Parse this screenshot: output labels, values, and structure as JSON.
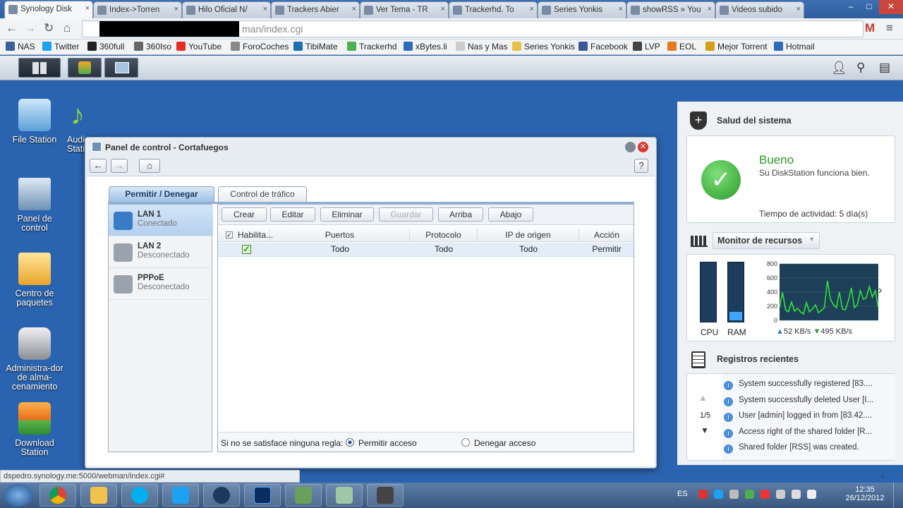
{
  "browser": {
    "tabs": [
      {
        "title": "Synology Disk",
        "active": true
      },
      {
        "title": "Index->Torren"
      },
      {
        "title": "Hilo Oficial N/"
      },
      {
        "title": "Trackers Abier"
      },
      {
        "title": "Ver Tema - TR"
      },
      {
        "title": "Trackerhd. To"
      },
      {
        "title": "Series Yonkis"
      },
      {
        "title": "showRSS » You"
      },
      {
        "title": "Videos subido"
      }
    ],
    "tab_close": "×",
    "window_controls": {
      "minimize": "–",
      "maximize": "□",
      "close": "✕"
    },
    "url": "man/index.cgi",
    "bookmarks": [
      "NAS",
      "Twitter",
      "360full",
      "360Iso",
      "YouTube",
      "ForoCoches",
      "TibiMate",
      "Trackerhd",
      "xBytes.li",
      "Nas y Mas",
      "Series Yonkis",
      "Facebook",
      "LVP",
      "EOL",
      "Mejor Torrent",
      "Hotmail"
    ]
  },
  "desktop": {
    "icons": [
      "File Station",
      "Audio Station",
      "Panel de control",
      "Centro de paquetes",
      "Administra-dor de alma-cenamiento",
      "Download Station"
    ]
  },
  "window": {
    "title": "Panel de control - Cortafuegos",
    "help": "?",
    "tabs": [
      "Permitir / Denegar",
      "Control de tráfico"
    ],
    "interfaces": [
      {
        "name": "LAN 1",
        "status": "Conectado"
      },
      {
        "name": "LAN 2",
        "status": "Desconectado"
      },
      {
        "name": "PPPoE",
        "status": "Desconectado"
      }
    ],
    "buttons": [
      "Crear",
      "Editar",
      "Eliminar",
      "Guardar",
      "Arriba",
      "Abajo"
    ],
    "columns": [
      "Habilita...",
      "Puertos",
      "Protocolo",
      "IP de origen",
      "Acción"
    ],
    "rows": [
      {
        "enabled": true,
        "ports": "Todo",
        "protocol": "Todo",
        "source_ip": "Todo",
        "action": "Permitir"
      }
    ],
    "footer": {
      "label": "Si no se satisface ninguna regla:",
      "allow": "Permitir acceso",
      "deny": "Denegar acceso",
      "selected": "allow"
    }
  },
  "widgets": {
    "health": {
      "title": "Salud del sistema",
      "status": "Bueno",
      "message": "Su DiskStation funciona bien.",
      "uptime": "Tiempo de actividad: 5 día(s)"
    },
    "monitor": {
      "title": "Monitor de recursos",
      "cpu_label": "CPU",
      "ram_label": "RAM",
      "cpu_level": 0.0,
      "ram_level": 0.15,
      "upload": "52 KB/s",
      "download": "495 KB/s"
    },
    "logs": {
      "title": "Registros recientes",
      "page": "1/5",
      "entries": [
        "System successfully registered [83....",
        "System successfully deleted User [I...",
        "User [admin] logged in from [83.42....",
        "Access right of the shared folder [R...",
        "Shared folder [RSS] was created."
      ]
    }
  },
  "status_url": "dspedro.synology.me:5000/webman/index.cgi#",
  "taskbar": {
    "language": "ES",
    "time": "12:35",
    "date": "26/12/2012"
  },
  "chart_data": {
    "type": "line",
    "title": "",
    "xlabel": "",
    "ylabel": "",
    "ylim": [
      0,
      800
    ],
    "yticks": [
      800,
      600,
      400,
      200,
      0
    ],
    "series": [
      {
        "values": [
          180,
          400,
          150,
          120,
          260,
          130,
          170,
          120,
          90,
          250,
          120,
          160,
          220,
          110,
          140,
          180,
          560,
          300,
          220,
          180,
          400,
          160,
          150,
          280,
          460,
          180,
          220,
          420,
          300,
          320,
          480,
          330,
          420,
          180
        ]
      }
    ]
  }
}
